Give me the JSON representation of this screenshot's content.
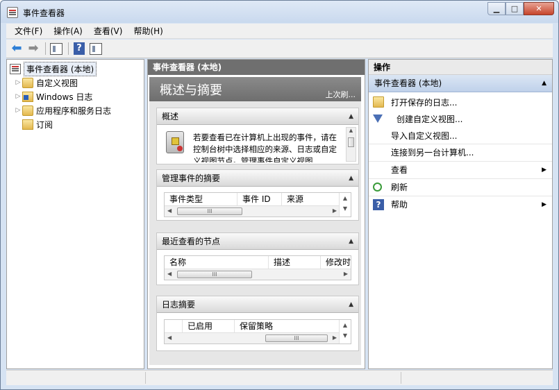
{
  "window": {
    "title": "事件查看器"
  },
  "menu": [
    "文件(F)",
    "操作(A)",
    "查看(V)",
    "帮助(H)"
  ],
  "toolbar": {
    "icons": [
      "back-arrow-icon",
      "forward-arrow-icon",
      "show-hide-tree-icon",
      "help-icon",
      "show-hide-action-icon"
    ]
  },
  "tree": {
    "root": "事件查看器 (本地)",
    "items": [
      "自定义视图",
      "Windows 日志",
      "应用程序和服务日志",
      "订阅"
    ]
  },
  "center": {
    "header": "事件查看器 (本地)",
    "overview_title": "概述与摘要",
    "refresh_link": "上次刷...",
    "overview_section": {
      "title": "概述",
      "text": "若要查看已在计算机上出现的事件，请在控制台树中选择相应的来源、日志或自定义视图节点。管理事件自定义视图"
    },
    "events_summary": {
      "title": "管理事件的摘要",
      "columns": [
        "事件类型",
        "事件 ID",
        "来源"
      ]
    },
    "recent_nodes": {
      "title": "最近查看的节点",
      "columns": [
        "名称",
        "描述",
        "修改时"
      ]
    },
    "log_summary": {
      "title": "日志摘要",
      "columns": [
        "",
        "已启用",
        "保留策略"
      ]
    }
  },
  "actions": {
    "header": "操作",
    "group": "事件查看器 (本地)",
    "items": [
      {
        "label": "打开保存的日志...",
        "icon": "open-folder-icon"
      },
      {
        "label": "创建自定义视图...",
        "icon": "filter-icon"
      },
      {
        "label": "导入自定义视图...",
        "icon": ""
      },
      {
        "label": "连接到另一台计算机...",
        "icon": ""
      },
      {
        "label": "查看",
        "icon": ""
      },
      {
        "label": "刷新",
        "icon": "refresh-icon"
      },
      {
        "label": "帮助",
        "icon": "help-icon"
      }
    ]
  },
  "hscroll_thumb": "III"
}
